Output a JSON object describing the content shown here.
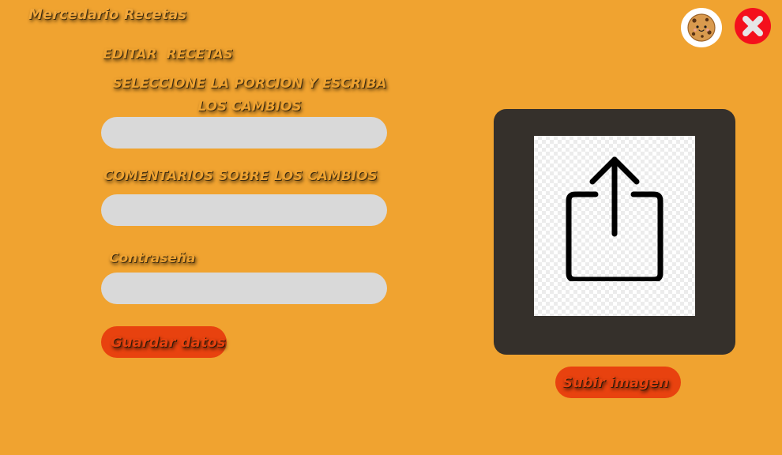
{
  "app": {
    "title": "Mercedario Recetas"
  },
  "form": {
    "section_title": "EDITAR  RECETAS",
    "portion_label": "SELECCIONE LA PORCION Y ESCRIBA LOS CAMBIOS",
    "portion_value": "",
    "comments_label": "COMENTARIOS SOBRE LOS CAMBIOS",
    "comments_value": "",
    "password_label": "Contraseña",
    "password_value": "",
    "save_label": "Guardar datos"
  },
  "image_upload": {
    "upload_label": "Subir imagen",
    "preview_icon": "share-upload-icon"
  },
  "header": {
    "avatar_icon": "cookie-icon",
    "close_icon": "close-icon"
  },
  "colors": {
    "background": "#f0a330",
    "button": "#e8420f",
    "field": "#d9d9d9",
    "panel": "#35302b",
    "close": "#f4101c"
  }
}
